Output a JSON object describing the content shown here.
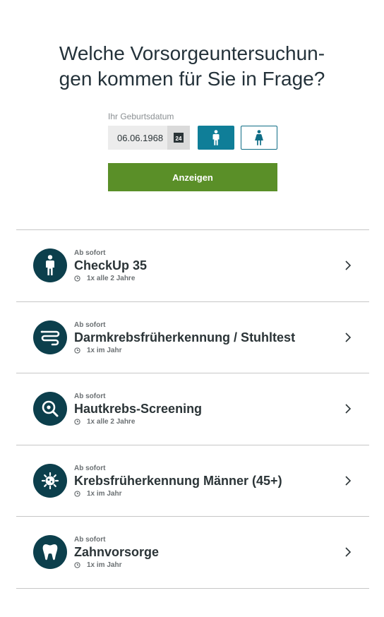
{
  "heading": {
    "line1": "Welche Vorsorgeuntersuchun-",
    "line2": "gen kommen für Sie in Frage?"
  },
  "form": {
    "date_label": "Ihr Geburtsdatum",
    "date_value": "06.06.1968",
    "calendar_day": "24",
    "selected_gender": "male",
    "submit_label": "Anzeigen"
  },
  "colors": {
    "accent_teal": "#0f7e98",
    "button_green": "#5a8f28",
    "icon_circle": "#0c3f4c"
  },
  "items": [
    {
      "since": "Ab sofort",
      "title": "CheckUp 35",
      "frequency": "1x alle 2 Jahre",
      "icon": "person-icon"
    },
    {
      "since": "Ab sofort",
      "title": "Darmkrebsfrüherkennung / Stuhltest",
      "frequency": "1x im Jahr",
      "icon": "intestine-icon"
    },
    {
      "since": "Ab sofort",
      "title": "Hautkrebs-Screening",
      "frequency": "1x alle 2 Jahre",
      "icon": "magnifier-icon"
    },
    {
      "since": "Ab sofort",
      "title": "Krebsfrüherkennung Männer (45+)",
      "frequency": "1x im Jahr",
      "icon": "cell-icon"
    },
    {
      "since": "Ab sofort",
      "title": "Zahnvorsorge",
      "frequency": "1x im Jahr",
      "icon": "tooth-icon"
    }
  ]
}
